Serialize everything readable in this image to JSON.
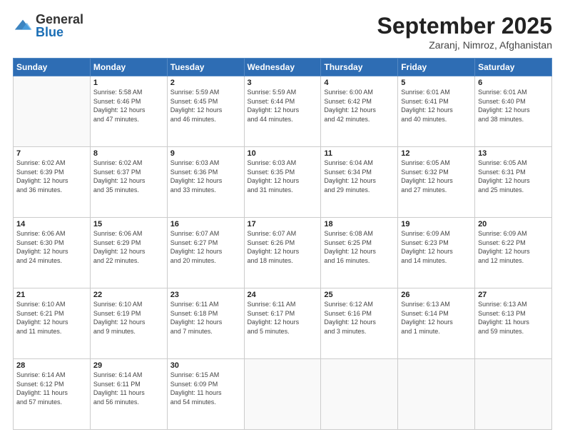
{
  "header": {
    "logo_general": "General",
    "logo_blue": "Blue",
    "month_title": "September 2025",
    "subtitle": "Zaranj, Nimroz, Afghanistan"
  },
  "weekdays": [
    "Sunday",
    "Monday",
    "Tuesday",
    "Wednesday",
    "Thursday",
    "Friday",
    "Saturday"
  ],
  "weeks": [
    [
      {
        "day": "",
        "info": ""
      },
      {
        "day": "1",
        "info": "Sunrise: 5:58 AM\nSunset: 6:46 PM\nDaylight: 12 hours\nand 47 minutes."
      },
      {
        "day": "2",
        "info": "Sunrise: 5:59 AM\nSunset: 6:45 PM\nDaylight: 12 hours\nand 46 minutes."
      },
      {
        "day": "3",
        "info": "Sunrise: 5:59 AM\nSunset: 6:44 PM\nDaylight: 12 hours\nand 44 minutes."
      },
      {
        "day": "4",
        "info": "Sunrise: 6:00 AM\nSunset: 6:42 PM\nDaylight: 12 hours\nand 42 minutes."
      },
      {
        "day": "5",
        "info": "Sunrise: 6:01 AM\nSunset: 6:41 PM\nDaylight: 12 hours\nand 40 minutes."
      },
      {
        "day": "6",
        "info": "Sunrise: 6:01 AM\nSunset: 6:40 PM\nDaylight: 12 hours\nand 38 minutes."
      }
    ],
    [
      {
        "day": "7",
        "info": "Sunrise: 6:02 AM\nSunset: 6:39 PM\nDaylight: 12 hours\nand 36 minutes."
      },
      {
        "day": "8",
        "info": "Sunrise: 6:02 AM\nSunset: 6:37 PM\nDaylight: 12 hours\nand 35 minutes."
      },
      {
        "day": "9",
        "info": "Sunrise: 6:03 AM\nSunset: 6:36 PM\nDaylight: 12 hours\nand 33 minutes."
      },
      {
        "day": "10",
        "info": "Sunrise: 6:03 AM\nSunset: 6:35 PM\nDaylight: 12 hours\nand 31 minutes."
      },
      {
        "day": "11",
        "info": "Sunrise: 6:04 AM\nSunset: 6:34 PM\nDaylight: 12 hours\nand 29 minutes."
      },
      {
        "day": "12",
        "info": "Sunrise: 6:05 AM\nSunset: 6:32 PM\nDaylight: 12 hours\nand 27 minutes."
      },
      {
        "day": "13",
        "info": "Sunrise: 6:05 AM\nSunset: 6:31 PM\nDaylight: 12 hours\nand 25 minutes."
      }
    ],
    [
      {
        "day": "14",
        "info": "Sunrise: 6:06 AM\nSunset: 6:30 PM\nDaylight: 12 hours\nand 24 minutes."
      },
      {
        "day": "15",
        "info": "Sunrise: 6:06 AM\nSunset: 6:29 PM\nDaylight: 12 hours\nand 22 minutes."
      },
      {
        "day": "16",
        "info": "Sunrise: 6:07 AM\nSunset: 6:27 PM\nDaylight: 12 hours\nand 20 minutes."
      },
      {
        "day": "17",
        "info": "Sunrise: 6:07 AM\nSunset: 6:26 PM\nDaylight: 12 hours\nand 18 minutes."
      },
      {
        "day": "18",
        "info": "Sunrise: 6:08 AM\nSunset: 6:25 PM\nDaylight: 12 hours\nand 16 minutes."
      },
      {
        "day": "19",
        "info": "Sunrise: 6:09 AM\nSunset: 6:23 PM\nDaylight: 12 hours\nand 14 minutes."
      },
      {
        "day": "20",
        "info": "Sunrise: 6:09 AM\nSunset: 6:22 PM\nDaylight: 12 hours\nand 12 minutes."
      }
    ],
    [
      {
        "day": "21",
        "info": "Sunrise: 6:10 AM\nSunset: 6:21 PM\nDaylight: 12 hours\nand 11 minutes."
      },
      {
        "day": "22",
        "info": "Sunrise: 6:10 AM\nSunset: 6:19 PM\nDaylight: 12 hours\nand 9 minutes."
      },
      {
        "day": "23",
        "info": "Sunrise: 6:11 AM\nSunset: 6:18 PM\nDaylight: 12 hours\nand 7 minutes."
      },
      {
        "day": "24",
        "info": "Sunrise: 6:11 AM\nSunset: 6:17 PM\nDaylight: 12 hours\nand 5 minutes."
      },
      {
        "day": "25",
        "info": "Sunrise: 6:12 AM\nSunset: 6:16 PM\nDaylight: 12 hours\nand 3 minutes."
      },
      {
        "day": "26",
        "info": "Sunrise: 6:13 AM\nSunset: 6:14 PM\nDaylight: 12 hours\nand 1 minute."
      },
      {
        "day": "27",
        "info": "Sunrise: 6:13 AM\nSunset: 6:13 PM\nDaylight: 11 hours\nand 59 minutes."
      }
    ],
    [
      {
        "day": "28",
        "info": "Sunrise: 6:14 AM\nSunset: 6:12 PM\nDaylight: 11 hours\nand 57 minutes."
      },
      {
        "day": "29",
        "info": "Sunrise: 6:14 AM\nSunset: 6:11 PM\nDaylight: 11 hours\nand 56 minutes."
      },
      {
        "day": "30",
        "info": "Sunrise: 6:15 AM\nSunset: 6:09 PM\nDaylight: 11 hours\nand 54 minutes."
      },
      {
        "day": "",
        "info": ""
      },
      {
        "day": "",
        "info": ""
      },
      {
        "day": "",
        "info": ""
      },
      {
        "day": "",
        "info": ""
      }
    ]
  ]
}
